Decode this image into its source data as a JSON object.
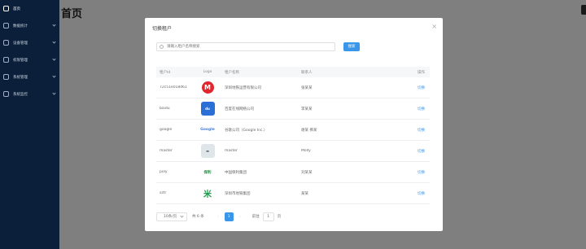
{
  "sidebar": {
    "items": [
      {
        "label": "首页",
        "active": true
      },
      {
        "label": "数据统计",
        "active": false
      },
      {
        "label": "设备管理",
        "active": false
      },
      {
        "label": "权限管理",
        "active": false
      },
      {
        "label": "系统管理",
        "active": false
      },
      {
        "label": "系统监控",
        "active": false
      }
    ]
  },
  "page": {
    "title": "首页"
  },
  "dialog": {
    "title": "切换租户",
    "close": "×",
    "search_placeholder": "请输入租户名称搜索",
    "search_button": "搜索",
    "columns": [
      "租户Id",
      "Logo",
      "租户名称",
      "联系人",
      "操作"
    ],
    "rows": [
      {
        "id": "72c51e018d61",
        "logo": "M",
        "name": "深圳地铁运营有限公司",
        "contact": "张某某",
        "op": "切换"
      },
      {
        "id": "baidu",
        "logo": "du",
        "name": "百度在线网络公司",
        "contact": "李某某",
        "op": "切换"
      },
      {
        "id": "google",
        "logo": "Google",
        "name": "谷歌公司（Google Inc.）",
        "contact": "谢某 佛某",
        "op": "切换"
      },
      {
        "id": "master",
        "logo": "▬",
        "name": "master",
        "contact": "Molly",
        "op": "切换"
      },
      {
        "id": "poly",
        "logo": "保利",
        "name": "中国保利集团",
        "contact": "刘某某",
        "op": "切换"
      },
      {
        "id": "sztr",
        "logo": "米",
        "name": "深圳市地铁集团",
        "contact": "某某",
        "op": "切换"
      }
    ],
    "pagination": {
      "page_size": "10条/页",
      "total": "共 6 条",
      "prev": "‹",
      "current": "1",
      "next": "›",
      "goto_label": "前往",
      "goto_value": "1",
      "page_suffix": "页"
    }
  }
}
